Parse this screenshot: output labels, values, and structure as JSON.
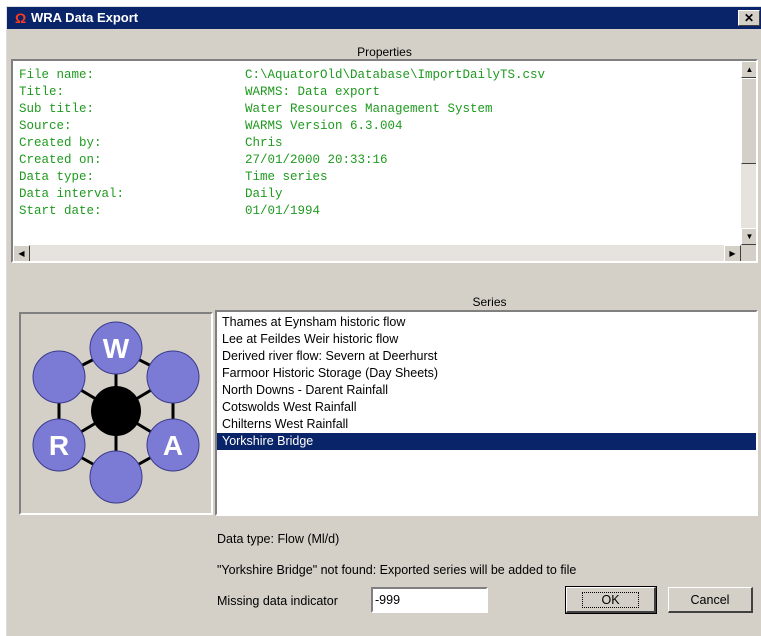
{
  "window": {
    "icon": "omega-icon",
    "icon_glyph": "Ω",
    "title": "WRA Data Export",
    "close_glyph": "✕"
  },
  "properties": {
    "label": "Properties",
    "rows": [
      {
        "key": "File name:",
        "value": "C:\\AquatorOld\\Database\\ImportDailyTS.csv"
      },
      {
        "key": "Title:",
        "value": "WARMS: Data export"
      },
      {
        "key": "Sub title:",
        "value": "Water Resources Management System"
      },
      {
        "key": "Source:",
        "value": "WARMS Version  6.3.004"
      },
      {
        "key": "Created by:",
        "value": "Chris"
      },
      {
        "key": "Created on:",
        "value": "27/01/2000 20:33:16"
      },
      {
        "key": "Data type:",
        "value": "Time series"
      },
      {
        "key": "Data interval:",
        "value": "Daily"
      },
      {
        "key": "Start date:",
        "value": "01/01/1994"
      }
    ],
    "text_color": "#1f9a1f"
  },
  "logo": {
    "letters": [
      "W",
      "R",
      "A"
    ],
    "circle_color": "#7b7bd6",
    "center_color": "#000000"
  },
  "series": {
    "label": "Series",
    "items": [
      "Thames at Eynsham historic flow",
      "Lee at Feildes Weir historic flow",
      "Derived river flow: Severn at Deerhurst",
      "Farmoor Historic Storage (Day Sheets)",
      "North Downs - Darent Rainfall",
      "Cotswolds West Rainfall",
      "Chilterns West Rainfall",
      "Yorkshire Bridge"
    ],
    "selected_index": 7,
    "selection_color": "#0a246a"
  },
  "data_type_text": "Data type: Flow (Ml/d)",
  "status_text": "\"Yorkshire Bridge\" not found: Exported series will be added to file",
  "missing": {
    "label": "Missing data indicator",
    "value": "-999"
  },
  "buttons": {
    "ok": "OK",
    "cancel": "Cancel"
  }
}
